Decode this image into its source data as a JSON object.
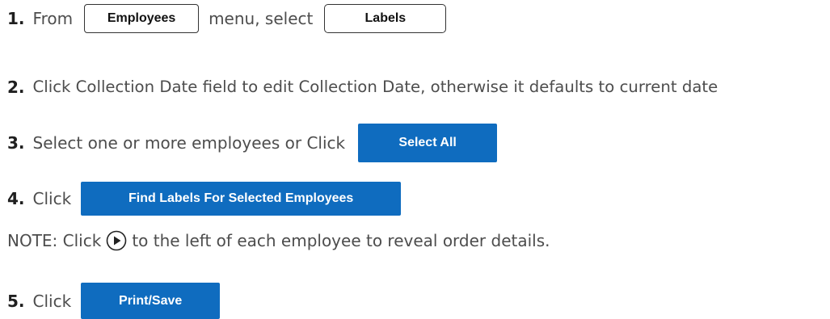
{
  "steps": [
    {
      "number": "1.",
      "text_before": "From",
      "menu_button": "Employees",
      "text_middle": "menu, select",
      "select_button": "Labels"
    },
    {
      "number": "2.",
      "text": "Click Collection Date field to edit Collection Date, otherwise it defaults to current date"
    },
    {
      "number": "3.",
      "text": "Select one or more employees or Click",
      "button": "Select All"
    },
    {
      "number": "4.",
      "text": "Click",
      "button": "Find Labels For Selected Employees",
      "note_before": "NOTE: Click",
      "note_icon": "play-circle-icon",
      "note_after": "to the left of each employee to reveal order details."
    },
    {
      "number": "5.",
      "text": "Click",
      "button": "Print/Save"
    }
  ],
  "colors": {
    "accent": "#0f6cbf",
    "step_number": "#1f1f1f",
    "body_text": "#4d4d4d",
    "background": "#ffffff"
  }
}
